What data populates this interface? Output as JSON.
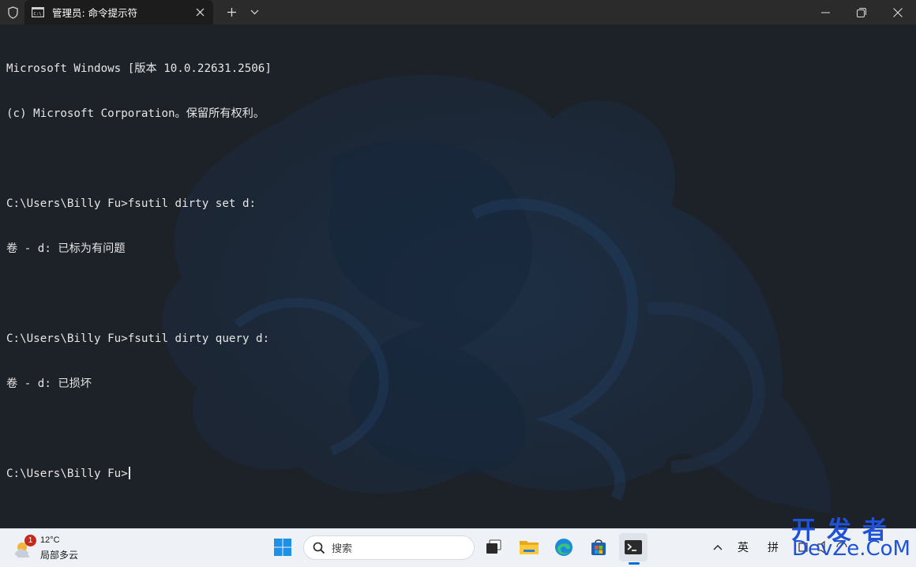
{
  "window": {
    "tab_title": "管理员: 命令提示符",
    "tab_icon": "cmd-icon",
    "buttons": {
      "shield": "shield-icon",
      "new_tab": "plus-icon",
      "tab_dropdown": "chevron-down-icon",
      "minimize": "minimize-icon",
      "maximize": "restore-icon",
      "close": "close-icon"
    }
  },
  "console": {
    "lines": [
      "Microsoft Windows [版本 10.0.22631.2506]",
      "(c) Microsoft Corporation。保留所有权利。",
      "",
      "C:\\Users\\Billy Fu>fsutil dirty set d:",
      "卷 - d: 已标为有问题",
      "",
      "C:\\Users\\Billy Fu>fsutil dirty query d:",
      "卷 - d: 已损坏",
      "",
      "C:\\Users\\Billy Fu>"
    ]
  },
  "taskbar": {
    "weather": {
      "badge": "1",
      "temperature": "12°C",
      "description": "局部多云"
    },
    "search_placeholder": "搜索",
    "apps": [
      "windows-start-icon",
      "task-view-icon",
      "file-explorer-icon",
      "edge-icon",
      "store-icon",
      "terminal-icon"
    ],
    "tray": {
      "ime_lang": "英",
      "ime_mode": "拼"
    }
  },
  "watermark": {
    "line1": "开发者",
    "line2": "DevZe.CoM"
  },
  "colors": {
    "titlebar": "#2b2b2b",
    "terminal_bg": "#1d2128",
    "taskbar": "#eef1f6",
    "accent": "#0a6ed1",
    "watermark": "#1f52d6"
  }
}
